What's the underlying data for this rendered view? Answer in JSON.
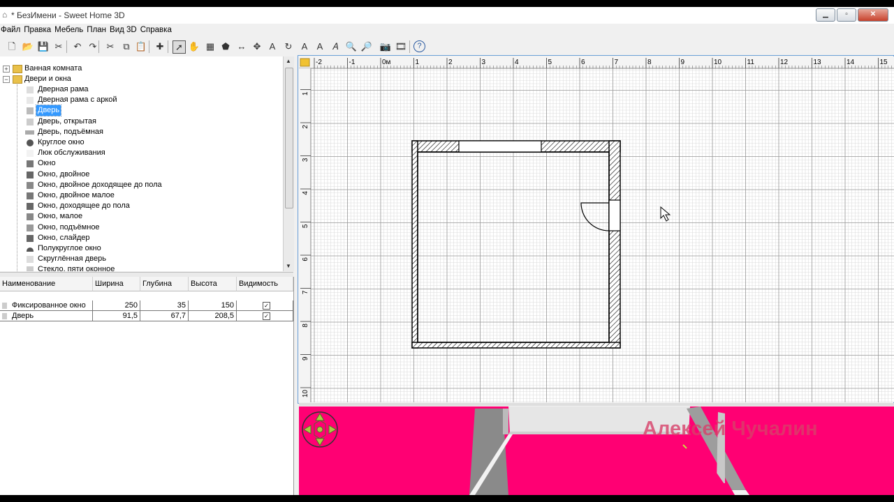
{
  "window": {
    "title": "* БезИмени - Sweet Home 3D",
    "minimize": "▁",
    "maximize": "▫",
    "close": "✕"
  },
  "menu": [
    "Файл",
    "Правка",
    "Мебель",
    "План",
    "Вид 3D",
    "Справка"
  ],
  "toolbar": [
    "new-icon",
    "open-icon",
    "save-icon",
    "preferences-icon",
    "undo-icon",
    "redo-icon",
    "cut-icon",
    "copy-icon",
    "paste-icon",
    "add-furniture-icon",
    "select-icon",
    "pan-icon",
    "create-walls-icon",
    "create-rooms-icon",
    "create-dimensions-icon",
    "create-labels-icon",
    "add-text-icon",
    "rotate-icon",
    "text-style-icon",
    "text-size-icon",
    "italic-icon",
    "zoom-in-icon",
    "zoom-out-icon",
    "photo-icon",
    "video-icon",
    "help-icon"
  ],
  "catalog": {
    "categories": [
      {
        "label": "Ванная комната",
        "expanded": false
      },
      {
        "label": "Двери и окна",
        "expanded": true
      }
    ],
    "items": [
      "Дверная рама",
      "Дверная рама с аркой",
      "Дверь",
      "Дверь, открытая",
      "Дверь, подъёмная",
      "Круглое окно",
      "Люк обслуживания",
      "Окно",
      "Окно, двойное",
      "Окно, двойное доходящее до пола",
      "Окно, двойное малое",
      "Окно, доходящее до пола",
      "Окно, малое",
      "Окно, подъёмное",
      "Окно, слайдер",
      "Полукруглое окно",
      "Скруглённая дверь",
      "Стекло, пяти оконное"
    ],
    "selected_index": 2
  },
  "furniture": {
    "columns": [
      "Наименование",
      "Ширина",
      "Глубина",
      "Высота",
      "Видимость"
    ],
    "rows": [
      {
        "name": "Фиксированное окно",
        "width": "250",
        "depth": "35",
        "height": "150",
        "visible": "✓"
      },
      {
        "name": "Дверь",
        "width": "91,5",
        "depth": "67,7",
        "height": "208,5",
        "visible": "✓"
      }
    ]
  },
  "plan": {
    "ruler_top": [
      "-2",
      "-1",
      "0м",
      "1",
      "2",
      "3",
      "4",
      "5",
      "6",
      "7",
      "8",
      "9",
      "10",
      "11",
      "12",
      "13",
      "14",
      "15"
    ],
    "ruler_left": [
      "1",
      "2",
      "3",
      "4",
      "5",
      "6",
      "7",
      "8",
      "9",
      "10"
    ]
  },
  "view3d": {
    "watermark": "Алексей Чучалин",
    "background": "#ff0073"
  }
}
